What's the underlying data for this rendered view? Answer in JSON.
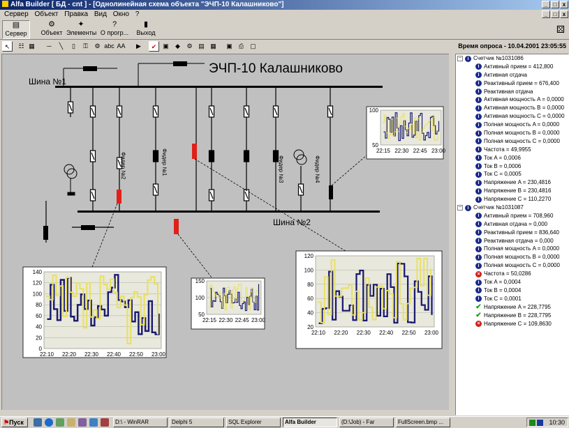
{
  "window": {
    "title": "Alfa Builder  [ БД - cnt ] - [Однолинейная схема объекта \"ЭЧП-10 Калашниково\"]",
    "min": "_",
    "max": "□",
    "close": "x",
    "mdi_restore": "×"
  },
  "menu": [
    "Сервер",
    "Объект",
    "Правка",
    "Вид",
    "Окно",
    "?"
  ],
  "toolbar": {
    "buttons": [
      {
        "label": "Сервер",
        "icon": "server-icon"
      },
      {
        "label": "Объект",
        "icon": "object-icon"
      },
      {
        "label": "Элементы",
        "icon": "elements-icon"
      },
      {
        "label": "О прогр...",
        "icon": "help-icon"
      },
      {
        "label": "Выход",
        "icon": "exit-icon"
      }
    ],
    "poll_time": "Время опроса - 10.04.2001 23:05:55"
  },
  "diagram": {
    "title": "ЭЧП-10 Калашниково",
    "bus1": "Шина №1",
    "bus2": "Шина №2",
    "feeders": [
      "Фидер №2",
      "Фидер №1",
      "Фидер №3",
      "Фидер №4"
    ]
  },
  "tree": {
    "meters": [
      {
        "name": "Счетчик №1031086",
        "items": [
          {
            "text": "Активный прием =  412,800",
            "status": "info"
          },
          {
            "text": "Активная отдача",
            "status": "info"
          },
          {
            "text": "Реактивный прием =  676,400",
            "status": "info"
          },
          {
            "text": "Реактивная отдача",
            "status": "info"
          },
          {
            "text": "Активная мощность A =  0,0000",
            "status": "info"
          },
          {
            "text": "Активная мощность B =  0,0000",
            "status": "info"
          },
          {
            "text": "Активная мощность C =  0,0000",
            "status": "info"
          },
          {
            "text": "Полная мощность A =  0,0000",
            "status": "info"
          },
          {
            "text": "Полная мощность B =  0,0000",
            "status": "info"
          },
          {
            "text": "Полная мощность C =  0,0000",
            "status": "info"
          },
          {
            "text": "Частота =  49,9955",
            "status": "info"
          },
          {
            "text": "Ток A =  0,0006",
            "status": "info"
          },
          {
            "text": "Ток B =  0,0006",
            "status": "info"
          },
          {
            "text": "Ток C =  0,0005",
            "status": "info"
          },
          {
            "text": "Напряжение A = 230,4816",
            "status": "info"
          },
          {
            "text": "Напряжение B = 230,4816",
            "status": "info"
          },
          {
            "text": "Напряжение C = 110,2270",
            "status": "info"
          }
        ]
      },
      {
        "name": "Счетчик №1031087",
        "items": [
          {
            "text": "Активный прием =  708,960",
            "status": "info"
          },
          {
            "text": "Активная отдача =  0,000",
            "status": "info"
          },
          {
            "text": "Реактивный прием =  836,640",
            "status": "info"
          },
          {
            "text": "Реактивная отдача =  0,000",
            "status": "info"
          },
          {
            "text": "Полная мощность A =  0,0000",
            "status": "info"
          },
          {
            "text": "Полная мощность B =  0,0000",
            "status": "info"
          },
          {
            "text": "Полная мощность C =  0,0000",
            "status": "info"
          },
          {
            "text": "Частота = 50,0286",
            "status": "err"
          },
          {
            "text": "Ток A =  0,0004",
            "status": "info"
          },
          {
            "text": "Ток B =  0,0004",
            "status": "info"
          },
          {
            "text": "Ток C =  0,0001",
            "status": "info"
          },
          {
            "text": "Напряжение A = 228,7795",
            "status": "ok"
          },
          {
            "text": "Напряжение B = 228,7795",
            "status": "ok"
          },
          {
            "text": "Напряжение C = 109,8630",
            "status": "err"
          }
        ]
      }
    ]
  },
  "charts": {
    "small1": {
      "yticks": [
        "100",
        "50"
      ],
      "xticks": [
        "22:15",
        "22:30",
        "22:45",
        "23:00"
      ]
    },
    "small2": {
      "yticks": [
        "150",
        "100",
        "50"
      ],
      "xticks": [
        "22:15",
        "22:30",
        "22:45",
        "23:00"
      ]
    },
    "large1": {
      "yticks": [
        "140",
        "120",
        "100",
        "80",
        "60",
        "40",
        "20",
        "0"
      ],
      "xticks": [
        "22:10",
        "22:20",
        "22:30",
        "22:40",
        "22:50",
        "23:00"
      ]
    },
    "large2": {
      "yticks": [
        "120",
        "100",
        "80",
        "60",
        "40",
        "20"
      ],
      "xticks": [
        "22:10",
        "22:20",
        "22:30",
        "22:40",
        "22:50",
        "23:00"
      ]
    }
  },
  "taskbar": {
    "start": "Пуск",
    "tasks": [
      "D:\\ - WinRAR",
      "Delphi 5",
      "SQL Explorer",
      "Alfa Builder",
      "(D:\\Job) - Far",
      "FullScreen.bmp ..."
    ],
    "clock": "10:30"
  },
  "colors": {
    "accent": "#0a246a",
    "info": "#1a2a8a",
    "error": "#d0201a",
    "ok": "#1a9a1a",
    "series1": "#e8e060",
    "series2": "#1a1a70",
    "breaker_red": "#e0201a"
  }
}
